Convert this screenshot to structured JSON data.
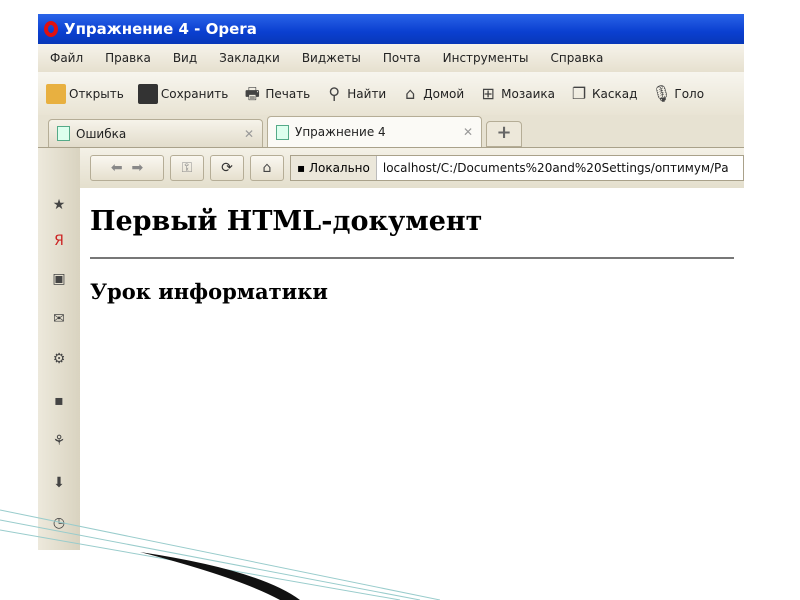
{
  "window": {
    "title": "Упражнение 4 - Opera"
  },
  "menu": [
    "Файл",
    "Правка",
    "Вид",
    "Закладки",
    "Виджеты",
    "Почта",
    "Инструменты",
    "Справка"
  ],
  "toolbar": [
    {
      "icon": "folder-icon",
      "label": "Открыть"
    },
    {
      "icon": "save-icon",
      "label": "Сохранить"
    },
    {
      "icon": "printer-icon",
      "label": "Печать"
    },
    {
      "icon": "search-icon",
      "label": "Найти"
    },
    {
      "icon": "home-icon",
      "label": "Домой"
    },
    {
      "icon": "tile-icon",
      "label": "Мозаика"
    },
    {
      "icon": "cascade-icon",
      "label": "Каскад"
    },
    {
      "icon": "microphone-icon",
      "label": "Голо"
    }
  ],
  "tabs": [
    {
      "label": "Ошибка",
      "active": false
    },
    {
      "label": "Упражнение 4",
      "active": true
    }
  ],
  "address": {
    "local_label": "Локально",
    "url": "localhost/C:/Documents%20and%20Settings/оптимум/Ра"
  },
  "panel_icons": [
    "bookmarks-icon",
    "yandex-icon",
    "notes-icon",
    "mail-icon",
    "widgets-icon",
    "notes-icon",
    "links-icon",
    "downloads-icon",
    "history-icon"
  ],
  "content": {
    "heading": "Первый HTML-документ",
    "subheading": "Урок информатики"
  }
}
